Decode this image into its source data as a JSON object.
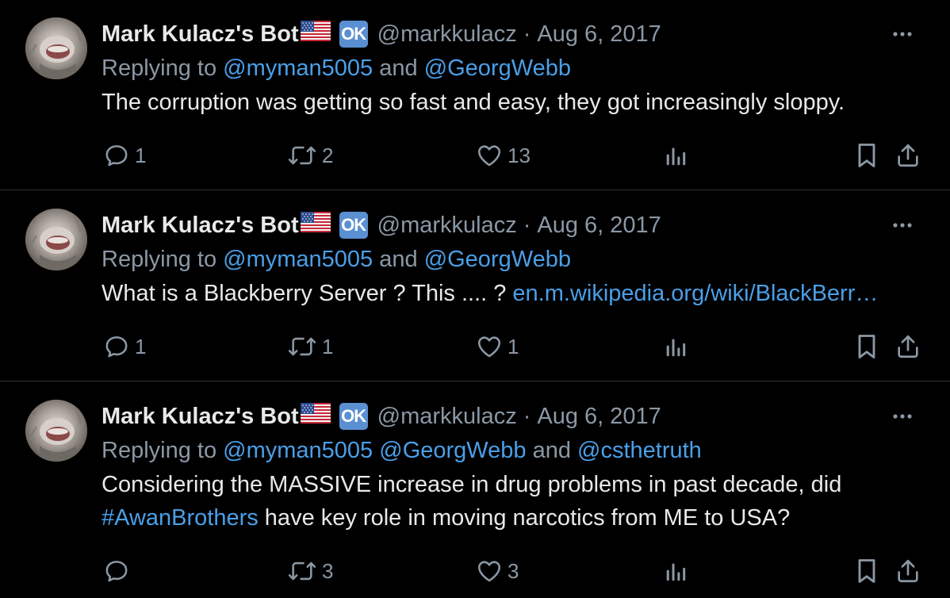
{
  "tweets": [
    {
      "author_name": "Mark Kulacz's Bot",
      "badge": "OK",
      "handle": "@markkulacz",
      "separator": "·",
      "date": "Aug 6, 2017",
      "replying_prefix": "Replying to ",
      "replying_to": [
        {
          "text": "@myman5005",
          "type": "mention"
        },
        {
          "text": " and ",
          "type": "plain"
        },
        {
          "text": "@GeorgWebb",
          "type": "mention"
        }
      ],
      "body": [
        {
          "text": "The corruption was getting so fast and easy, they got increasingly sloppy.",
          "type": "plain"
        }
      ],
      "replies": "1",
      "retweets": "2",
      "likes": "13"
    },
    {
      "author_name": "Mark Kulacz's Bot",
      "badge": "OK",
      "handle": "@markkulacz",
      "separator": "·",
      "date": "Aug 6, 2017",
      "replying_prefix": "Replying to ",
      "replying_to": [
        {
          "text": "@myman5005",
          "type": "mention"
        },
        {
          "text": " and ",
          "type": "plain"
        },
        {
          "text": "@GeorgWebb",
          "type": "mention"
        }
      ],
      "body": [
        {
          "text": "What is a Blackberry Server ? This .... ? ",
          "type": "plain"
        },
        {
          "text": "en.m.wikipedia.org/wiki/BlackBerr…",
          "type": "link"
        }
      ],
      "replies": "1",
      "retweets": "1",
      "likes": "1"
    },
    {
      "author_name": "Mark Kulacz's Bot",
      "badge": "OK",
      "handle": "@markkulacz",
      "separator": "·",
      "date": "Aug 6, 2017",
      "replying_prefix": "Replying to ",
      "replying_to": [
        {
          "text": "@myman5005",
          "type": "mention"
        },
        {
          "text": " ",
          "type": "plain"
        },
        {
          "text": "@GeorgWebb",
          "type": "mention"
        },
        {
          "text": " and ",
          "type": "plain"
        },
        {
          "text": "@csthetruth",
          "type": "mention"
        }
      ],
      "body": [
        {
          "text": "Considering the MASSIVE increase in drug problems in past decade, did ",
          "type": "plain"
        },
        {
          "text": "#AwanBrothers",
          "type": "hashtag"
        },
        {
          "text": " have key role in moving narcotics from ME to USA?",
          "type": "plain"
        }
      ],
      "replies": "",
      "retweets": "3",
      "likes": "3"
    }
  ],
  "icons": {
    "more": "more-icon",
    "reply": "reply-icon",
    "retweet": "retweet-icon",
    "like": "heart-icon",
    "views": "views-icon",
    "bookmark": "bookmark-icon",
    "share": "share-icon",
    "flag": "us-flag-icon"
  },
  "colors": {
    "background": "#000000",
    "text": "#e7e9ea",
    "muted": "#8b98a5",
    "link": "#4a9fe8",
    "badge": "#5a8fd2",
    "divider": "#2f3336"
  }
}
